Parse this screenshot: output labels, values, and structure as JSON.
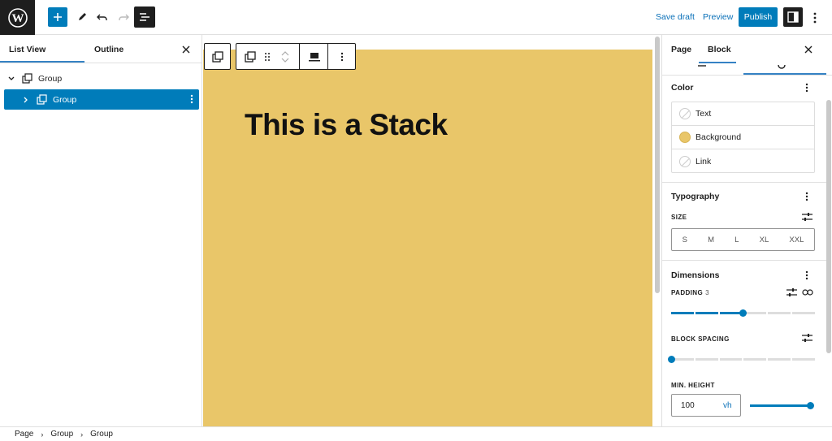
{
  "topbar": {
    "save_draft": "Save draft",
    "preview": "Preview",
    "publish": "Publish"
  },
  "left_panel": {
    "tabs": [
      "List View",
      "Outline"
    ],
    "tree": [
      {
        "label": "Group",
        "level": 0,
        "expanded": true,
        "selected": false
      },
      {
        "label": "Group",
        "level": 1,
        "expanded": false,
        "selected": true
      }
    ]
  },
  "canvas": {
    "heading": "This is a Stack",
    "block_background": "#e9c669"
  },
  "right_panel": {
    "tabs": [
      "Page",
      "Block"
    ],
    "color": {
      "title": "Color",
      "items": [
        {
          "label": "Text",
          "swatch": "none"
        },
        {
          "label": "Background",
          "swatch": "#e9c669"
        },
        {
          "label": "Link",
          "swatch": "none"
        }
      ]
    },
    "typography": {
      "title": "Typography",
      "size_label": "SIZE",
      "sizes": [
        "S",
        "M",
        "L",
        "XL",
        "XXL"
      ]
    },
    "dimensions": {
      "title": "Dimensions",
      "padding_label": "PADDING",
      "padding_value": "3",
      "block_spacing_label": "BLOCK SPACING",
      "min_height_label": "MIN. HEIGHT",
      "min_height_value": "100",
      "min_height_unit": "vh"
    }
  },
  "breadcrumb": [
    "Page",
    "Group",
    "Group"
  ],
  "colors": {
    "accent": "#007cba",
    "dark": "#1e1e1e"
  }
}
